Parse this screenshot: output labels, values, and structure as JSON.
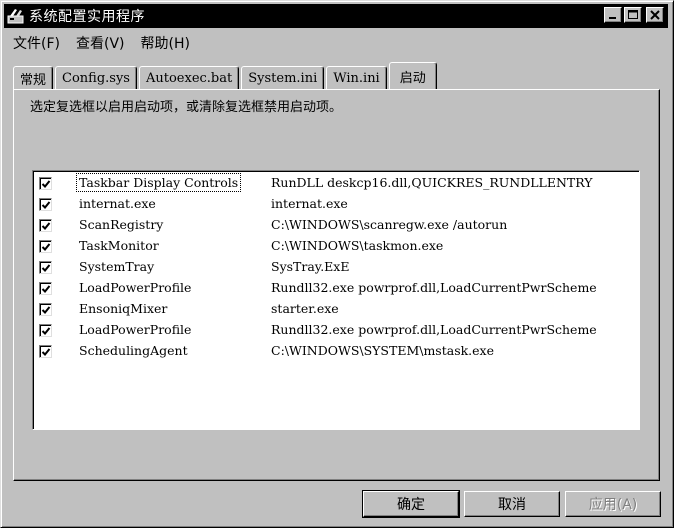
{
  "window": {
    "title": "系统配置实用程序",
    "app_icon": "system-config-icon"
  },
  "menu": [
    "文件(F)",
    "查看(V)",
    "帮助(H)"
  ],
  "tabs": [
    {
      "label": "常规",
      "active": false
    },
    {
      "label": "Config.sys",
      "active": false
    },
    {
      "label": "Autoexec.bat",
      "active": false
    },
    {
      "label": "System.ini",
      "active": false
    },
    {
      "label": "Win.ini",
      "active": false
    },
    {
      "label": "启动",
      "active": true
    }
  ],
  "instruction": "选定复选框以启用启动项，或清除复选框禁用启动项。",
  "startup_items": [
    {
      "name": "Taskbar Display Controls",
      "command": "RunDLL deskcp16.dll,QUICKRES_RUNDLLENTRY",
      "checked": true,
      "selected": true
    },
    {
      "name": "internat.exe",
      "command": "internat.exe",
      "checked": true,
      "selected": false
    },
    {
      "name": "ScanRegistry",
      "command": "C:\\WINDOWS\\scanregw.exe /autorun",
      "checked": true,
      "selected": false
    },
    {
      "name": "TaskMonitor",
      "command": "C:\\WINDOWS\\taskmon.exe",
      "checked": true,
      "selected": false
    },
    {
      "name": "SystemTray",
      "command": "SysTray.ExE",
      "checked": true,
      "selected": false
    },
    {
      "name": "LoadPowerProfile",
      "command": "Rundll32.exe powrprof.dll,LoadCurrentPwrScheme",
      "checked": true,
      "selected": false
    },
    {
      "name": "EnsoniqMixer",
      "command": "starter.exe",
      "checked": true,
      "selected": false
    },
    {
      "name": "LoadPowerProfile",
      "command": "Rundll32.exe powrprof.dll,LoadCurrentPwrScheme",
      "checked": true,
      "selected": false
    },
    {
      "name": "SchedulingAgent",
      "command": "C:\\WINDOWS\\SYSTEM\\mstask.exe",
      "checked": true,
      "selected": false
    }
  ],
  "buttons": {
    "ok": "确定",
    "cancel": "取消",
    "apply": "应用(A)"
  }
}
